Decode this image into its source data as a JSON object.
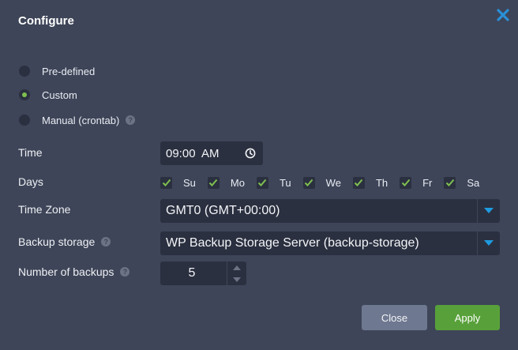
{
  "dialog": {
    "title": "Configure",
    "close_icon": "close-x-icon"
  },
  "schedule": {
    "options": [
      {
        "label": "Pre-defined",
        "checked": false
      },
      {
        "label": "Custom",
        "checked": true
      },
      {
        "label": "Manual (crontab)",
        "checked": false,
        "help": "?"
      }
    ]
  },
  "time": {
    "label": "Time",
    "value": "09:00  AM",
    "icon": "clock-icon"
  },
  "days": {
    "label": "Days",
    "items": [
      {
        "label": "Su",
        "checked": true
      },
      {
        "label": "Mo",
        "checked": true
      },
      {
        "label": "Tu",
        "checked": true
      },
      {
        "label": "We",
        "checked": true
      },
      {
        "label": "Th",
        "checked": true
      },
      {
        "label": "Fr",
        "checked": true
      },
      {
        "label": "Sa",
        "checked": true
      }
    ]
  },
  "timezone": {
    "label": "Time Zone",
    "value": "GMT0 (GMT+00:00)"
  },
  "backup_storage": {
    "label": "Backup storage",
    "help": "?",
    "value": "WP Backup Storage Server (backup-storage)"
  },
  "backups_count": {
    "label": "Number of backups",
    "help": "?",
    "value": "5"
  },
  "buttons": {
    "close": "Close",
    "apply": "Apply"
  },
  "colors": {
    "background": "#3e4558",
    "input": "#2b3040",
    "accent_green": "#58a13a",
    "check_green": "#7ec050",
    "select_arrow": "#1e9be0",
    "close_x": "#2a8fd8"
  }
}
